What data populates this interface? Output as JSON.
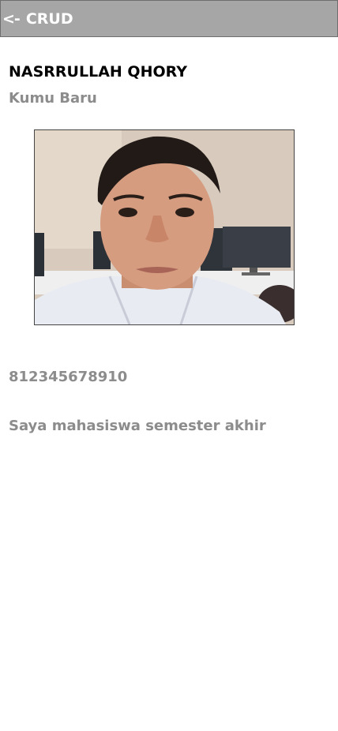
{
  "header": {
    "back_arrow": "<-",
    "title": "CRUD"
  },
  "profile": {
    "name": "NASRRULLAH QHORY",
    "subtitle": "Kumu Baru",
    "phone": "812345678910",
    "description": "Saya mahasiswa semester akhir"
  },
  "colors": {
    "header_bg": "#a6a6a6",
    "muted_text": "#8c8c8c"
  }
}
